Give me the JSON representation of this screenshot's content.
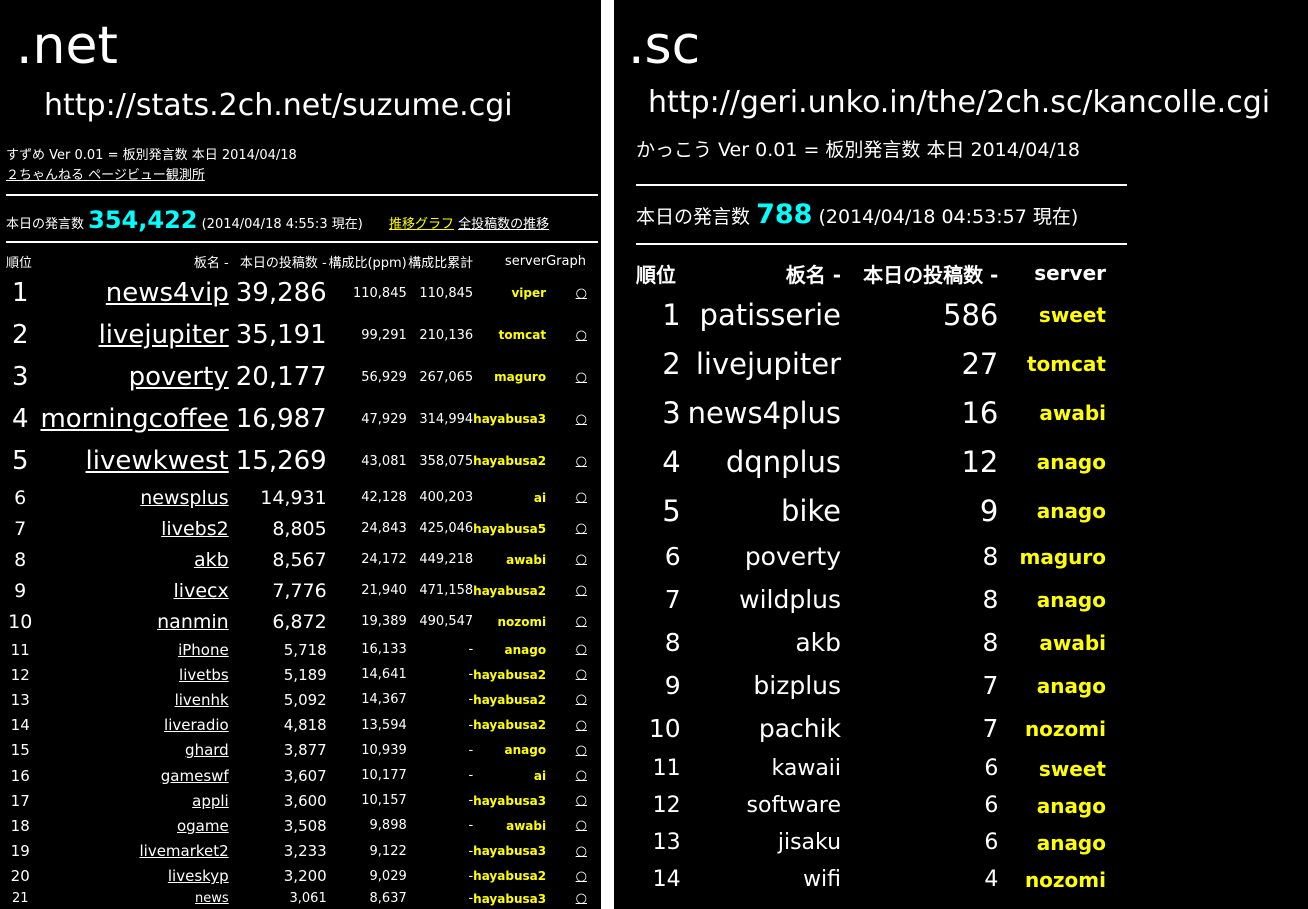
{
  "net": {
    "title": ".net",
    "url": "http://stats.2ch.net/suzume.cgi",
    "version_line": "すずめ Ver 0.01 = 板別発言数 本日 2014/04/18",
    "observatory_link": "２ちゃんねる ページビュー観測所",
    "today_label": "本日の発言数",
    "today_count": "354,422",
    "timestamp": "(2014/04/18 4:55:3 現在)",
    "graph_link": "推移グラフ",
    "all_posts_link": "全投稿数の推移",
    "headers": {
      "rank": "順位",
      "board": "板名 -",
      "count": "本日の投稿数 -",
      "ppm": "構成比(ppm)",
      "cum": "構成比累計",
      "server": "server",
      "graph": "Graph"
    },
    "rows": [
      {
        "rank": "1",
        "board": "news4vip",
        "count": "39,286",
        "ppm": "110,845",
        "cum": "110,845",
        "server": "viper",
        "graph": "○"
      },
      {
        "rank": "2",
        "board": "livejupiter",
        "count": "35,191",
        "ppm": "99,291",
        "cum": "210,136",
        "server": "tomcat",
        "graph": "○"
      },
      {
        "rank": "3",
        "board": "poverty",
        "count": "20,177",
        "ppm": "56,929",
        "cum": "267,065",
        "server": "maguro",
        "graph": "○"
      },
      {
        "rank": "4",
        "board": "morningcoffee",
        "count": "16,987",
        "ppm": "47,929",
        "cum": "314,994",
        "server": "hayabusa3",
        "graph": "○"
      },
      {
        "rank": "5",
        "board": "livewkwest",
        "count": "15,269",
        "ppm": "43,081",
        "cum": "358,075",
        "server": "hayabusa2",
        "graph": "○"
      },
      {
        "rank": "6",
        "board": "newsplus",
        "count": "14,931",
        "ppm": "42,128",
        "cum": "400,203",
        "server": "ai",
        "graph": "○"
      },
      {
        "rank": "7",
        "board": "livebs2",
        "count": "8,805",
        "ppm": "24,843",
        "cum": "425,046",
        "server": "hayabusa5",
        "graph": "○"
      },
      {
        "rank": "8",
        "board": "akb",
        "count": "8,567",
        "ppm": "24,172",
        "cum": "449,218",
        "server": "awabi",
        "graph": "○"
      },
      {
        "rank": "9",
        "board": "livecx",
        "count": "7,776",
        "ppm": "21,940",
        "cum": "471,158",
        "server": "hayabusa2",
        "graph": "○"
      },
      {
        "rank": "10",
        "board": "nanmin",
        "count": "6,872",
        "ppm": "19,389",
        "cum": "490,547",
        "server": "nozomi",
        "graph": "○"
      },
      {
        "rank": "11",
        "board": "iPhone",
        "count": "5,718",
        "ppm": "16,133",
        "cum": "-",
        "server": "anago",
        "graph": "○"
      },
      {
        "rank": "12",
        "board": "livetbs",
        "count": "5,189",
        "ppm": "14,641",
        "cum": "-",
        "server": "hayabusa2",
        "graph": "○"
      },
      {
        "rank": "13",
        "board": "livenhk",
        "count": "5,092",
        "ppm": "14,367",
        "cum": "-",
        "server": "hayabusa2",
        "graph": "○"
      },
      {
        "rank": "14",
        "board": "liveradio",
        "count": "4,818",
        "ppm": "13,594",
        "cum": "-",
        "server": "hayabusa2",
        "graph": "○"
      },
      {
        "rank": "15",
        "board": "ghard",
        "count": "3,877",
        "ppm": "10,939",
        "cum": "-",
        "server": "anago",
        "graph": "○"
      },
      {
        "rank": "16",
        "board": "gameswf",
        "count": "3,607",
        "ppm": "10,177",
        "cum": "-",
        "server": "ai",
        "graph": "○"
      },
      {
        "rank": "17",
        "board": "appli",
        "count": "3,600",
        "ppm": "10,157",
        "cum": "-",
        "server": "hayabusa3",
        "graph": "○"
      },
      {
        "rank": "18",
        "board": "ogame",
        "count": "3,508",
        "ppm": "9,898",
        "cum": "-",
        "server": "awabi",
        "graph": "○"
      },
      {
        "rank": "19",
        "board": "livemarket2",
        "count": "3,233",
        "ppm": "9,122",
        "cum": "-",
        "server": "hayabusa3",
        "graph": "○"
      },
      {
        "rank": "20",
        "board": "liveskyp",
        "count": "3,200",
        "ppm": "9,029",
        "cum": "-",
        "server": "hayabusa2",
        "graph": "○"
      },
      {
        "rank": "21",
        "board": "news",
        "count": "3,061",
        "ppm": "8,637",
        "cum": "-",
        "server": "hayabusa3",
        "graph": "○"
      }
    ]
  },
  "sc": {
    "title": ".sc",
    "url": "http://geri.unko.in/the/2ch.sc/kancolle.cgi",
    "version_line": "かっこう Ver 0.01 = 板別発言数 本日 2014/04/18",
    "today_label": "本日の発言数",
    "today_count": "788",
    "timestamp": "(2014/04/18 04:53:57 現在)",
    "headers": {
      "rank": "順位",
      "board": "板名 -",
      "count": "本日の投稿数 -",
      "server": "server"
    },
    "rows": [
      {
        "rank": "1",
        "board": "patisserie",
        "count": "586",
        "server": "sweet"
      },
      {
        "rank": "2",
        "board": "livejupiter",
        "count": "27",
        "server": "tomcat"
      },
      {
        "rank": "3",
        "board": "news4plus",
        "count": "16",
        "server": "awabi"
      },
      {
        "rank": "4",
        "board": "dqnplus",
        "count": "12",
        "server": "anago"
      },
      {
        "rank": "5",
        "board": "bike",
        "count": "9",
        "server": "anago"
      },
      {
        "rank": "6",
        "board": "poverty",
        "count": "8",
        "server": "maguro"
      },
      {
        "rank": "7",
        "board": "wildplus",
        "count": "8",
        "server": "anago"
      },
      {
        "rank": "8",
        "board": "akb",
        "count": "8",
        "server": "awabi"
      },
      {
        "rank": "9",
        "board": "bizplus",
        "count": "7",
        "server": "anago"
      },
      {
        "rank": "10",
        "board": "pachik",
        "count": "7",
        "server": "nozomi"
      },
      {
        "rank": "11",
        "board": "kawaii",
        "count": "6",
        "server": "sweet"
      },
      {
        "rank": "12",
        "board": "software",
        "count": "6",
        "server": "anago"
      },
      {
        "rank": "13",
        "board": "jisaku",
        "count": "6",
        "server": "anago"
      },
      {
        "rank": "14",
        "board": "wifi",
        "count": "4",
        "server": "nozomi"
      }
    ]
  }
}
